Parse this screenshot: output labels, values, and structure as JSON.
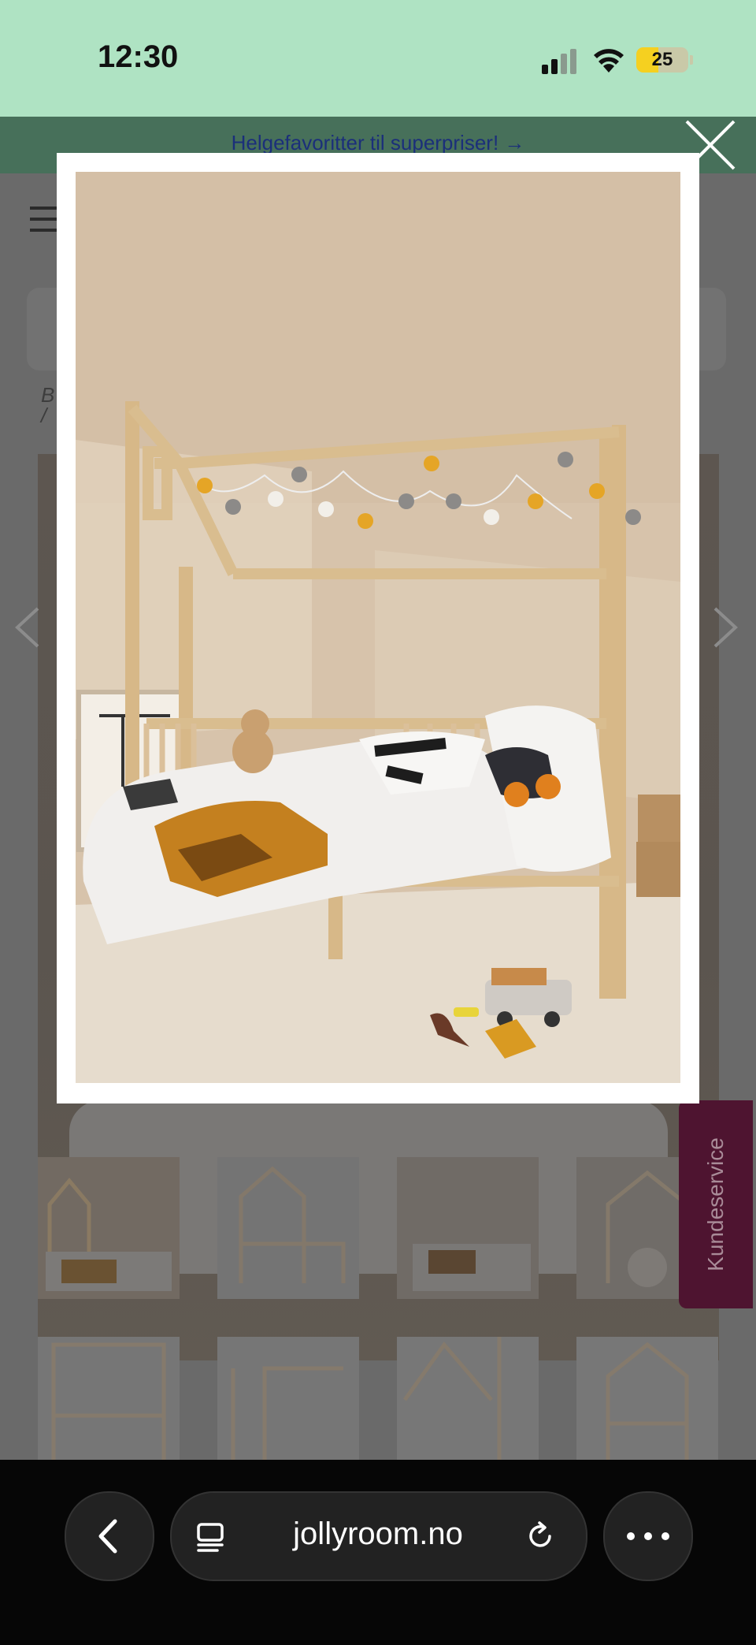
{
  "status_bar": {
    "time": "12:30",
    "battery": "25"
  },
  "promo": {
    "text": "Helgefavoritter til superpriser! →"
  },
  "breadcrumb": {
    "text": "B\n/"
  },
  "side_tab": {
    "label": "Kundeservice"
  },
  "browser": {
    "url": "jollyroom.no"
  },
  "colors": {
    "status_bg": "#afe3c3",
    "promo_bg": "#47705a",
    "kundeservice_bg": "#4e1430",
    "browser_bg": "#060606"
  },
  "icons": [
    "signal-icon",
    "wifi-icon",
    "battery-icon",
    "menu-icon",
    "chevron-left-icon",
    "chevron-right-icon",
    "close-icon",
    "back-icon",
    "tabs-icon",
    "reload-icon",
    "more-icon"
  ]
}
